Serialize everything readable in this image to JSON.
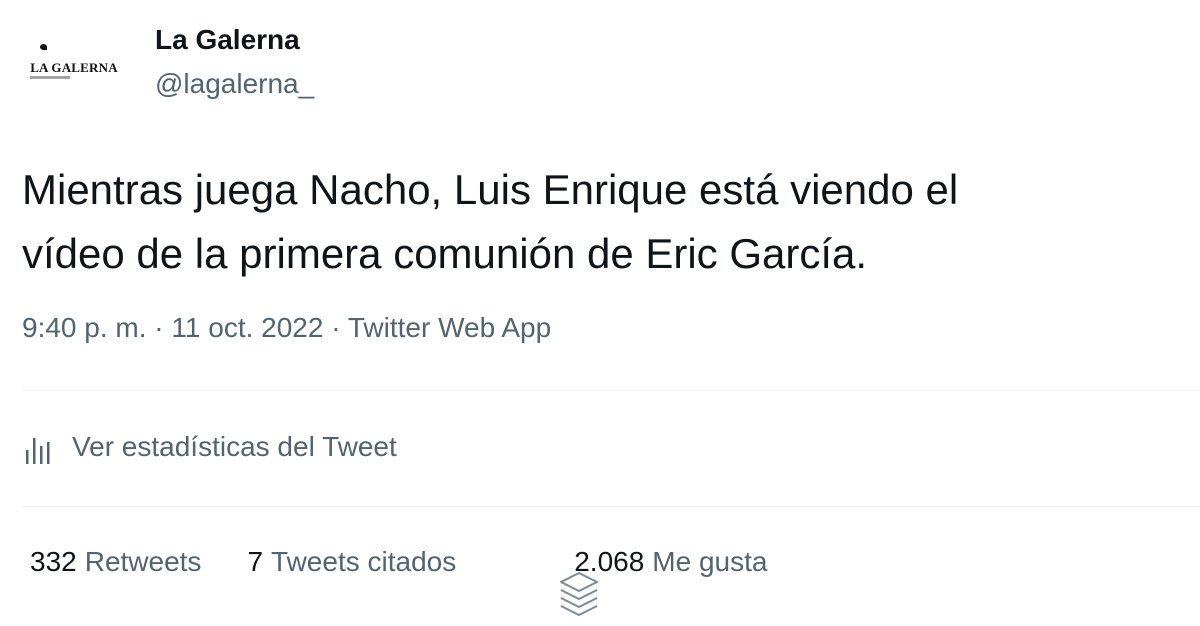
{
  "author": {
    "display_name": "La Galerna",
    "handle": "@lagalerna_",
    "avatar_text": "LA GALERNA"
  },
  "tweet": {
    "text_line1": "Mientras juega Nacho, Luis Enrique está viendo el",
    "text_line2": "vídeo de la primera comunión de Eric García."
  },
  "meta": {
    "time": "9:40 p. m.",
    "separator": " · ",
    "date": "11 oct. 2022",
    "source": "Twitter Web App"
  },
  "analytics": {
    "label": "Ver estadísticas del Tweet",
    "icon": "bar-chart-icon"
  },
  "counts": [
    {
      "number": "332",
      "label": "Retweets"
    },
    {
      "number": "7",
      "label": "Tweets citados"
    },
    {
      "number": "2.068",
      "label": "Me gusta"
    }
  ],
  "colors": {
    "primary_text": "#0f1419",
    "secondary_text": "#536471",
    "divider": "#eff3f4"
  },
  "overlay_icon": "layers-icon"
}
